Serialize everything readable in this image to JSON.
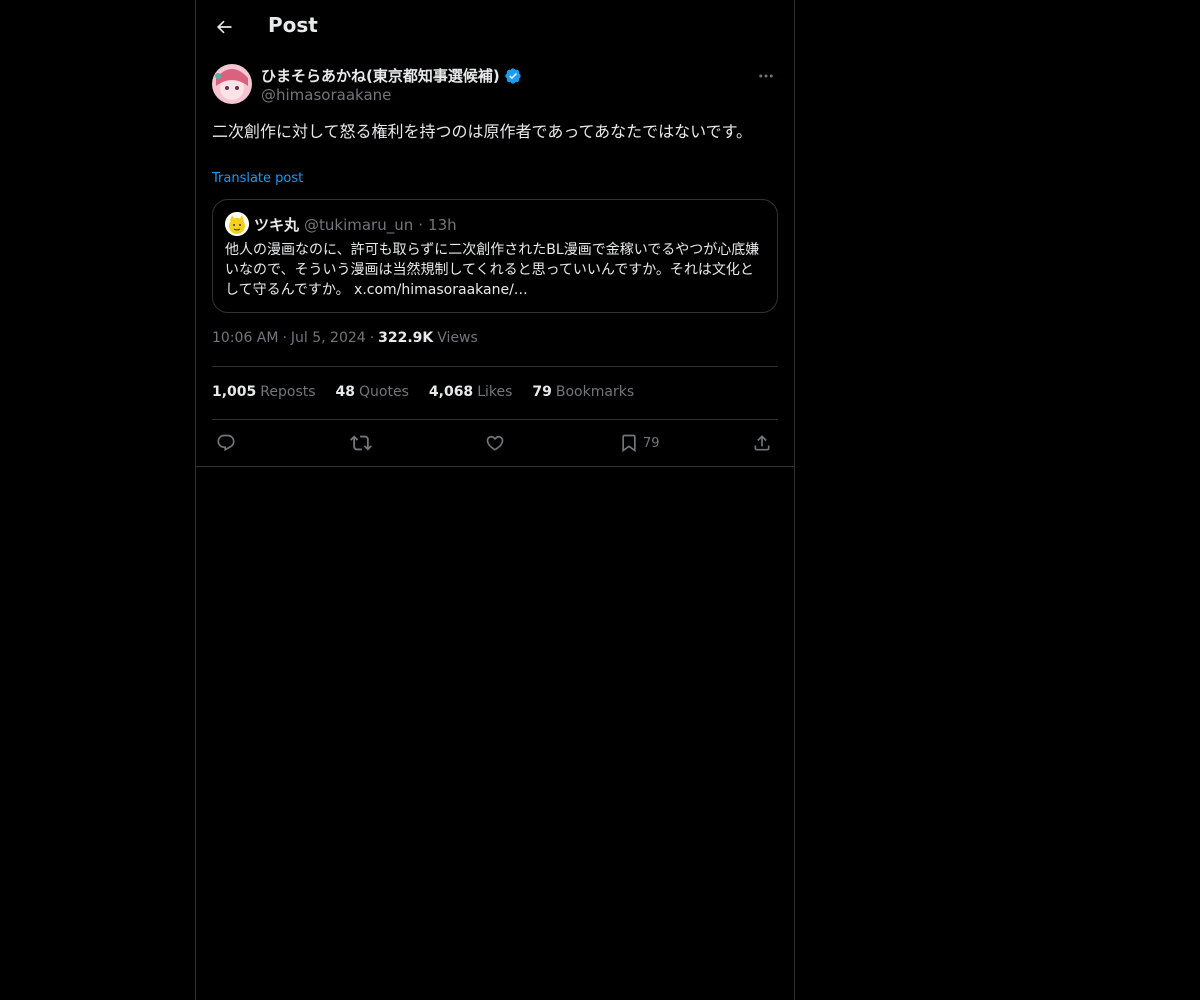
{
  "header": {
    "title": "Post",
    "back_icon": "arrow-left-icon"
  },
  "post": {
    "author_name": "ひまそらあかね(東京都知事選候補)",
    "author_handle": "@himasoraakane",
    "verified_color": "#1d9bf0",
    "text": "二次創作に対して怒る権利を持つのは原作者であってあなたではないです。",
    "translate_label": "Translate post",
    "quote": {
      "name": "ツキ丸",
      "handle": "@tukimaru_un",
      "dot": "·",
      "time": "13h",
      "text": "他人の漫画なのに、許可も取らずに二次創作されたBL漫画で金稼いでるやつが心底嫌いなので、そういう漫画は当然規制してくれると思っていいんですか。それは文化として守るんですか。 x.com/himasoraakane/…"
    },
    "meta": {
      "time": "10:06 AM",
      "sep1": "·",
      "date": "Jul 5, 2024",
      "sep2": "·",
      "views_count": "322.9K",
      "views_label": "Views"
    },
    "stats": {
      "reposts_count": "1,005",
      "reposts_label": "Reposts",
      "quotes_count": "48",
      "quotes_label": "Quotes",
      "likes_count": "4,068",
      "likes_label": "Likes",
      "bookmarks_count": "79",
      "bookmarks_label": "Bookmarks"
    },
    "actions": {
      "reply_icon": "reply-icon",
      "repost_icon": "repost-icon",
      "like_icon": "heart-icon",
      "bookmark_icon": "bookmark-icon",
      "bookmark_count": "79",
      "share_icon": "share-icon"
    }
  },
  "colors": {
    "background": "#000000",
    "text": "#e7e9ea",
    "muted": "#71767b",
    "accent": "#1d9bf0",
    "border": "#2f3336"
  }
}
